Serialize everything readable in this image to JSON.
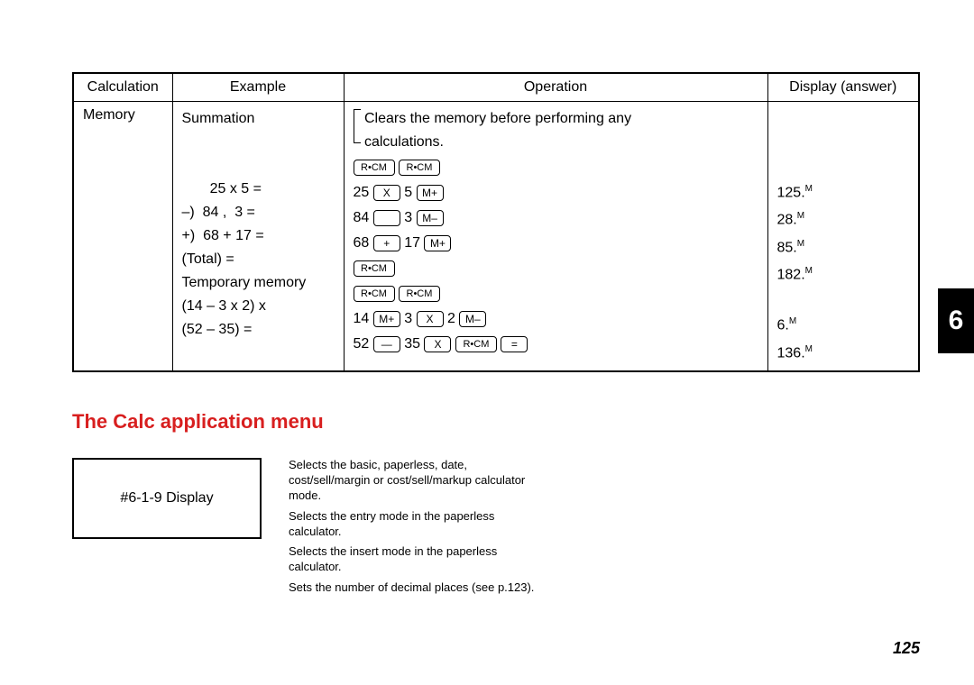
{
  "table": {
    "headers": {
      "calc": "Calculation",
      "example": "Example",
      "operation": "Operation",
      "display": "Display (answer)"
    },
    "calc_label": "Memory",
    "example": {
      "l1": "Summation",
      "l2": "       25 x 5 =",
      "l3": "–)  84 ,  3 =",
      "l4": "+)  68 + 17 =",
      "l5": "(Total) =",
      "l6": "Temporary memory",
      "l7": "(14 – 3 x 2) x",
      "l8": "(52 – 35) ="
    },
    "operation": {
      "memo_note1": "Clears the memory before performing any",
      "memo_note2": "calculations.",
      "r1a": "25",
      "r1b": "5",
      "r2a": "84",
      "r2b": "3",
      "r3a": "68",
      "r3b": "17",
      "r5a": "14",
      "r5b": "3",
      "r5c": "2",
      "r6a": "52",
      "r6b": "35"
    },
    "keys": {
      "rcm": "R•CM",
      "x": "X",
      "plus": "+",
      "minus": "—",
      "eq": "=",
      "mplus": "M+",
      "mminus": "M–"
    },
    "display": {
      "d1": "125.",
      "d1s": "M",
      "d2": "28.",
      "d2s": "M",
      "d3": "85.",
      "d3s": "M",
      "d4": "182.",
      "d4s": "M",
      "d5": "6.",
      "d5s": "M",
      "d6": "136.",
      "d6s": "M"
    }
  },
  "section_title": "The Calc application menu",
  "display_box": "#6-1-9 Display",
  "desc": {
    "d1": "Selects the basic, paperless, date, cost/sell/margin or cost/sell/markup calculator mode.",
    "d2": "Selects the entry mode in the paperless calculator.",
    "d3": "Selects the insert mode in the paperless calculator.",
    "d4": "Sets the number of decimal places (see p.123)."
  },
  "side_tab": "6",
  "page_number": "125"
}
